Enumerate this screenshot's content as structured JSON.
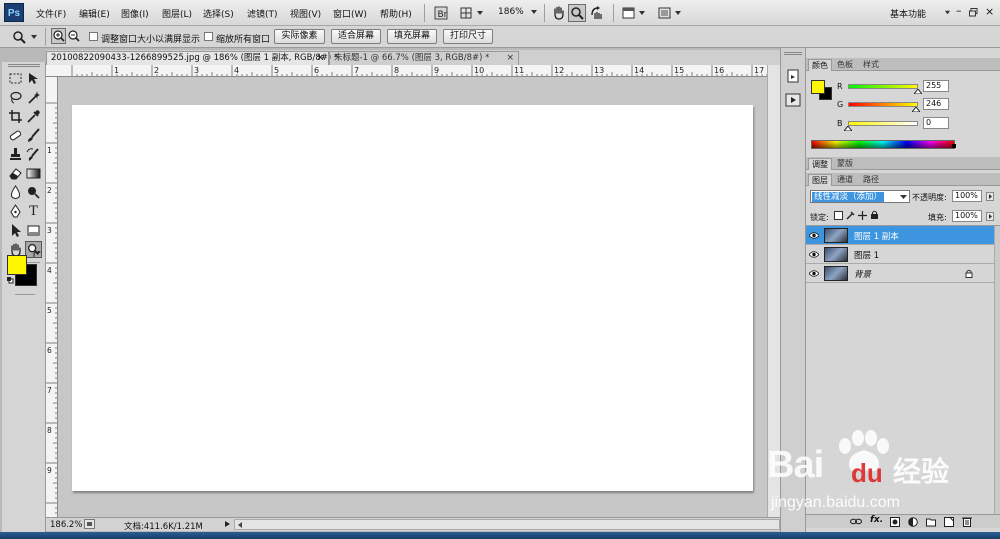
{
  "app": {
    "logo": "Ps"
  },
  "menu": {
    "items": [
      "文件(F)",
      "编辑(E)",
      "图像(I)",
      "图层(L)",
      "选择(S)",
      "滤镜(T)",
      "视图(V)",
      "窗口(W)",
      "帮助(H)"
    ],
    "zoom": "186%",
    "workspace": "基本功能"
  },
  "options": {
    "resize_windows": "调整窗口大小以满屏显示",
    "zoom_all": "缩放所有窗口",
    "actual_pixels": "实际像素",
    "fit_screen": "适合屏幕",
    "fill_screen": "填充屏幕",
    "print_size": "打印尺寸"
  },
  "tabs": [
    {
      "label": "20100822090433-1266899525.jpg @ 186% (图层 1 副本, RGB/8#) *",
      "close": "×"
    },
    {
      "label": "未标题-1 @ 66.7% (图层 3, RGB/8#) *",
      "close": "×"
    }
  ],
  "ruler_numbers": [
    "1",
    "2",
    "3",
    "4",
    "5",
    "6",
    "7",
    "8",
    "9",
    "10",
    "11",
    "12",
    "13",
    "14",
    "15",
    "16",
    "17"
  ],
  "ruler_left_numbers": [
    "1",
    "2",
    "3",
    "4",
    "5",
    "6",
    "7",
    "8",
    "9"
  ],
  "status": {
    "zoom": "186.2%",
    "doc": "文档:411.6K/1.21M"
  },
  "color_panel": {
    "tabs": [
      "颜色",
      "色板",
      "样式"
    ],
    "r_label": "R",
    "g_label": "G",
    "b_label": "B",
    "r": "255",
    "g": "246",
    "b": "0",
    "r_level": 1.0,
    "g_level": 0.965,
    "b_level": 0.0,
    "foreground": "#fff600",
    "background": "#000000"
  },
  "adjust_panel": {
    "tabs": [
      "调整",
      "蒙版"
    ]
  },
  "layers_panel": {
    "tabs": [
      "图层",
      "通道",
      "路径"
    ],
    "blend_mode": "线性减淡（添加）",
    "opacity_label": "不透明度:",
    "opacity": "100%",
    "lock_label": "锁定:",
    "fill_label": "填充:",
    "fill": "100%",
    "layers": [
      {
        "name": "图层 1 副本",
        "selected": true
      },
      {
        "name": "图层 1",
        "selected": false
      },
      {
        "name": "背景",
        "selected": false,
        "locked": true
      }
    ]
  },
  "watermark": {
    "brand": "Bai",
    "brand2": "du",
    "cn": "经验",
    "url": "jingyan.baidu.com"
  }
}
